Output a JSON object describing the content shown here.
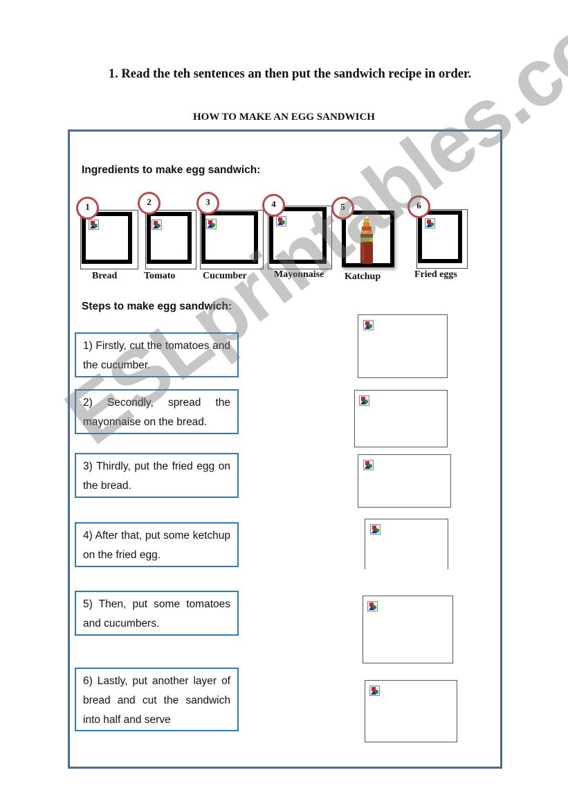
{
  "instruction": "1. Read the teh sentences an then put the sandwich recipe in order.",
  "doc_title": "HOW TO MAKE AN EGG SANDWICH",
  "ingredients_heading": "Ingredients to make egg sandwich:",
  "ingredients": [
    {
      "number": "1",
      "label": "Bread",
      "image": "broken-image-icon"
    },
    {
      "number": "2",
      "label": "Tomato",
      "image": "broken-image-icon"
    },
    {
      "number": "3",
      "label": "Cucumber",
      "image": "broken-image-icon"
    },
    {
      "number": "4",
      "label": "Mayonnaise",
      "image": "broken-image-icon"
    },
    {
      "number": "5",
      "label": "Katchup",
      "image": "ketchup-bottle-photo"
    },
    {
      "number": "6",
      "label": "Fried eggs",
      "image": "broken-image-icon"
    }
  ],
  "steps_heading": "Steps to make egg sandwich:",
  "steps": [
    {
      "text": "1)   Firstly, cut the tomatoes and the cucumber."
    },
    {
      "text": "2)    Secondly, spread the mayonnaise on the bread."
    },
    {
      "text": "3) Thirdly, put the fried egg on the bread."
    },
    {
      "text": "4)    After that, put some ketchup on the fried egg."
    },
    {
      "text": "5) Then, put some tomatoes and cucumbers."
    },
    {
      "text": "6)  Lastly, put another layer of bread and cut the sandwich into half and serve"
    }
  ],
  "step_images": [
    "broken-image-icon",
    "broken-image-icon",
    "broken-image-icon",
    "broken-image-icon",
    "broken-image-icon",
    "broken-image-icon"
  ],
  "watermark": "ESLprintables.com",
  "colors": {
    "frame_border": "#4a6b94",
    "step_border": "#2d7bc2",
    "badge_ring": "#b74a4c"
  }
}
